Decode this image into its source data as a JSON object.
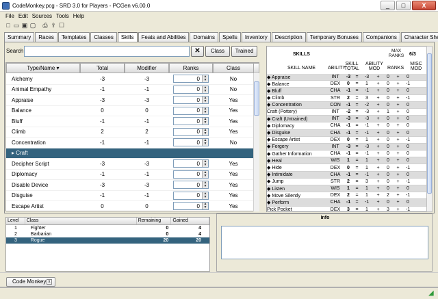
{
  "window": {
    "title": "CodeMonkey.pcg - SRD 3.0 for Players - PCGen v6.00.0",
    "min": "_",
    "max": "□",
    "close": "X"
  },
  "menu": [
    "File",
    "Edit",
    "Sources",
    "Tools",
    "Help"
  ],
  "toolbar_icons": [
    "new-icon",
    "open-icon",
    "save-icon",
    "close-file-icon",
    "print-icon",
    "export-icon",
    "party-icon"
  ],
  "tabs": [
    "Summary",
    "Races",
    "Templates",
    "Classes",
    "Skills",
    "Feats and Abilities",
    "Domains",
    "Spells",
    "Inventory",
    "Description",
    "Temporary Bonuses",
    "Companions",
    "Character Sheet"
  ],
  "active_tab": "Skills",
  "search": {
    "label": "Search:",
    "value": "",
    "clear": "✕",
    "class_btn": "Class",
    "trained_btn": "Trained"
  },
  "skill_table": {
    "headers": [
      "Type/Name ▾",
      "Total",
      "Modifier",
      "Ranks",
      "Class"
    ],
    "rows": [
      {
        "name": "Alchemy",
        "total": "-3",
        "mod": "-3",
        "ranks": "0",
        "cls": "No"
      },
      {
        "name": "Animal Empathy",
        "total": "-1",
        "mod": "-1",
        "ranks": "0",
        "cls": "No"
      },
      {
        "name": "Appraise",
        "total": "-3",
        "mod": "-3",
        "ranks": "0",
        "cls": "Yes"
      },
      {
        "name": "Balance",
        "total": "0",
        "mod": "0",
        "ranks": "0",
        "cls": "Yes"
      },
      {
        "name": "Bluff",
        "total": "-1",
        "mod": "-1",
        "ranks": "0",
        "cls": "Yes"
      },
      {
        "name": "Climb",
        "total": "2",
        "mod": "2",
        "ranks": "0",
        "cls": "Yes"
      },
      {
        "name": "Concentration",
        "total": "-1",
        "mod": "-1",
        "ranks": "0",
        "cls": "No"
      },
      {
        "name": "▸ Craft",
        "total": "",
        "mod": "",
        "ranks": "",
        "cls": ""
      },
      {
        "name": "Decipher Script",
        "total": "-3",
        "mod": "-3",
        "ranks": "0",
        "cls": "Yes"
      },
      {
        "name": "Diplomacy",
        "total": "-1",
        "mod": "-1",
        "ranks": "0",
        "cls": "Yes"
      },
      {
        "name": "Disable Device",
        "total": "-3",
        "mod": "-3",
        "ranks": "0",
        "cls": "Yes"
      },
      {
        "name": "Disguise",
        "total": "-1",
        "mod": "-1",
        "ranks": "0",
        "cls": "Yes"
      },
      {
        "name": "Escape Artist",
        "total": "0",
        "mod": "0",
        "ranks": "0",
        "cls": "Yes"
      }
    ]
  },
  "sheet": {
    "title": "SKILLS",
    "max_ranks_label": "MAX RANKS",
    "max_ranks_value": "6/3",
    "col_skill": "SKILL NAME",
    "col_ability": "ABILITY",
    "col_total": "SKILL TOTAL",
    "col_abmod": "ABILITY MOD",
    "col_ranks": "RANKS",
    "col_misc": "MISC MOD",
    "rows": [
      [
        "◆ Appraise",
        "INT",
        "-3",
        "=",
        "-3",
        "+",
        "0",
        "+",
        "0"
      ],
      [
        "◆ Balance",
        "DEX",
        "0",
        "=",
        "1",
        "+",
        "0",
        "+",
        "-1"
      ],
      [
        "◆ Bluff",
        "CHA",
        "-1",
        "=",
        "-1",
        "+",
        "0",
        "+",
        "0"
      ],
      [
        "◆ Climb",
        "STR",
        "2",
        "=",
        "3",
        "+",
        "0",
        "+",
        "-1"
      ],
      [
        "◆ Concentration",
        "CON",
        "-1",
        "=",
        "-2",
        "+",
        "0",
        "+",
        "0"
      ],
      [
        "   Craft (Pottery)",
        "INT",
        "-2",
        "=",
        "-3",
        "+",
        "1",
        "+",
        "0"
      ],
      [
        "◆ Craft (Untrained)",
        "INT",
        "-3",
        "=",
        "-3",
        "+",
        "0",
        "+",
        "0"
      ],
      [
        "◆ Diplomacy",
        "CHA",
        "-1",
        "=",
        "-1",
        "+",
        "0",
        "+",
        "0"
      ],
      [
        "◆ Disguise",
        "CHA",
        "-1",
        "=",
        "-1",
        "+",
        "0",
        "+",
        "0"
      ],
      [
        "◆ Escape Artist",
        "DEX",
        "0",
        "=",
        "1",
        "+",
        "0",
        "+",
        "-1"
      ],
      [
        "◆ Forgery",
        "INT",
        "-3",
        "=",
        "-3",
        "+",
        "0",
        "+",
        "0"
      ],
      [
        "◆ Gather Information",
        "CHA",
        "-1",
        "=",
        "-1",
        "+",
        "0",
        "+",
        "0"
      ],
      [
        "◆ Heal",
        "WIS",
        "1",
        "=",
        "1",
        "+",
        "0",
        "+",
        "0"
      ],
      [
        "◆ Hide",
        "DEX",
        "0",
        "=",
        "1",
        "+",
        "0",
        "+",
        "-1"
      ],
      [
        "◆ Intimidate",
        "CHA",
        "-1",
        "=",
        "-1",
        "+",
        "0",
        "+",
        "0"
      ],
      [
        "◆ Jump",
        "STR",
        "2",
        "=",
        "3",
        "+",
        "0",
        "+",
        "-1"
      ],
      [
        "◆ Listen",
        "WIS",
        "1",
        "=",
        "1",
        "+",
        "0",
        "+",
        "0"
      ],
      [
        "◆ Move Silently",
        "DEX",
        "2",
        "=",
        "1",
        "+",
        "2",
        "+",
        "-1"
      ],
      [
        "◆ Perform",
        "CHA",
        "-1",
        "=",
        "-1",
        "+",
        "0",
        "+",
        "0"
      ],
      [
        "   Pick Pocket",
        "DEX",
        "3",
        "=",
        "1",
        "+",
        "3",
        "+",
        "-1"
      ]
    ]
  },
  "levels": {
    "headers": [
      "Level",
      "Class",
      "Remaining",
      "Gained"
    ],
    "rows": [
      [
        "1",
        "Fighter",
        "0",
        "4"
      ],
      [
        "2",
        "Barbarian",
        "0",
        "4"
      ],
      [
        "3",
        "Rogue",
        "20",
        "20"
      ]
    ]
  },
  "info": {
    "title": "Info"
  },
  "character_tab": {
    "label": "Code Monkey",
    "close": "x"
  }
}
